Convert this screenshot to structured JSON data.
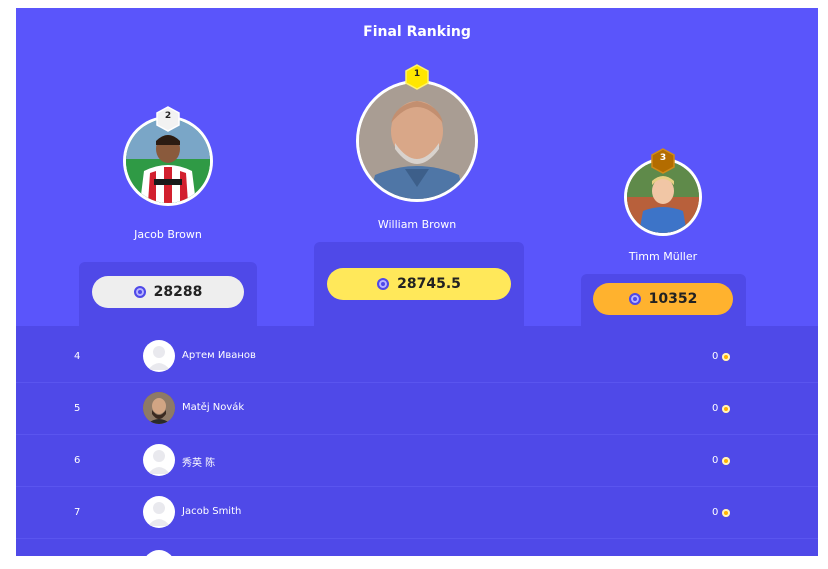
{
  "header": {
    "title": "Final Ranking"
  },
  "podium": [
    {
      "rank": "2",
      "name": "Jacob Brown",
      "score": "28288"
    },
    {
      "rank": "1",
      "name": "William Brown",
      "score": "28745.5"
    },
    {
      "rank": "3",
      "name": "Timm Müller",
      "score": "10352"
    }
  ],
  "colors": {
    "background": "#5a55fb",
    "panel": "#4f49e8",
    "gold": "#ffe85a",
    "silver": "#eeeeee",
    "bronze": "#ffb22e"
  },
  "rows": [
    {
      "rank": "4",
      "name": "Артем Иванов",
      "score": "0"
    },
    {
      "rank": "5",
      "name": "Matěj Novák",
      "score": "0"
    },
    {
      "rank": "6",
      "name": "秀英 陈",
      "score": "0"
    },
    {
      "rank": "7",
      "name": "Jacob Smith",
      "score": "0"
    }
  ]
}
